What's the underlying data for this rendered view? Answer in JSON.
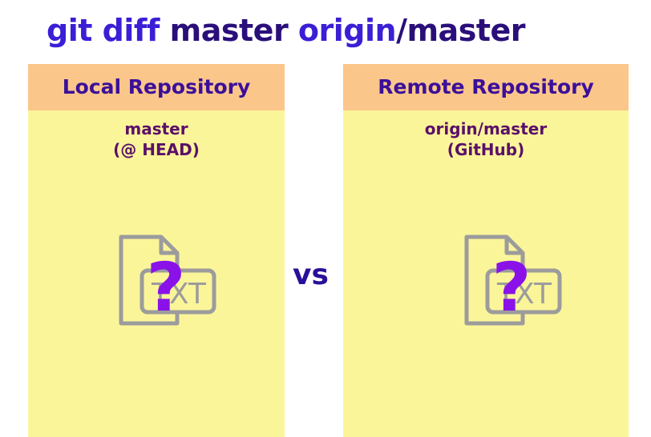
{
  "title": {
    "part1": "git diff ",
    "part2": "master ",
    "part3": "origin",
    "part4": "/master"
  },
  "colors": {
    "title_blue": "#3a1fd6",
    "title_dark": "#2a0f7a",
    "header_text": "#3b0f9a",
    "branch_text": "#5a1068",
    "panel_bg": "#fbf59a",
    "header_bg": "#fbc68a",
    "icon_gray": "#9c9c9c",
    "question_purple": "#8a12e8",
    "vs_color": "#2a0f9a"
  },
  "local": {
    "header": "Local Repository",
    "branch_line1": "master",
    "branch_line2": "(@ HEAD)",
    "icon": "txt-file-unknown-icon"
  },
  "remote": {
    "header": "Remote Repository",
    "branch_line1": "origin/master",
    "branch_line2": "(GitHub)",
    "icon": "txt-file-unknown-icon"
  },
  "vs_label": "vs",
  "file_icon_text": "TXT",
  "question_mark": "?"
}
